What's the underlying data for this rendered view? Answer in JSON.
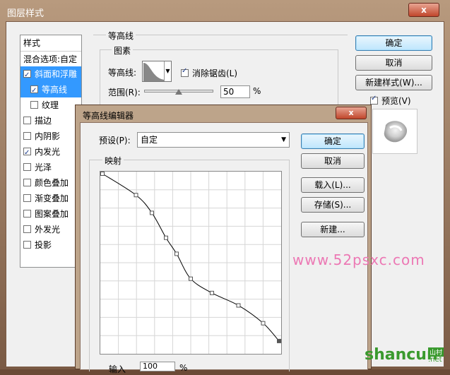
{
  "outer": {
    "title": "图层样式",
    "close_glyph": "x"
  },
  "styles_panel": {
    "header": "样式",
    "blend_label": "混合选项:自定",
    "items": [
      {
        "label": "斜面和浮雕",
        "checked": true,
        "selected": true,
        "sub": false
      },
      {
        "label": "等高线",
        "checked": true,
        "selected": true,
        "sub": true
      },
      {
        "label": "纹理",
        "checked": false,
        "selected": false,
        "sub": true
      },
      {
        "label": "描边",
        "checked": false,
        "selected": false,
        "sub": false
      },
      {
        "label": "内阴影",
        "checked": false,
        "selected": false,
        "sub": false
      },
      {
        "label": "内发光",
        "checked": true,
        "selected": false,
        "sub": false
      },
      {
        "label": "光泽",
        "checked": false,
        "selected": false,
        "sub": false
      },
      {
        "label": "颜色叠加",
        "checked": false,
        "selected": false,
        "sub": false
      },
      {
        "label": "渐变叠加",
        "checked": false,
        "selected": false,
        "sub": false
      },
      {
        "label": "图案叠加",
        "checked": false,
        "selected": false,
        "sub": false
      },
      {
        "label": "外发光",
        "checked": false,
        "selected": false,
        "sub": false
      },
      {
        "label": "投影",
        "checked": false,
        "selected": false,
        "sub": false
      }
    ]
  },
  "contour_panel": {
    "section_title": "等高线",
    "group_title": "图素",
    "contour_label": "等高线:",
    "antialias_label": "消除锯齿(L)",
    "antialias_checked": true,
    "range_label": "范围(R):",
    "range_value": "50",
    "range_unit": "%",
    "range_fraction": 0.5
  },
  "right_buttons": {
    "ok": "确定",
    "cancel": "取消",
    "new_style": "新建样式(W)...",
    "preview_label": "预览(V)",
    "preview_checked": true
  },
  "editor": {
    "title": "等高线编辑器",
    "close_glyph": "x",
    "preset_label": "预设(P):",
    "preset_value": "自定",
    "mapping_label": "映射",
    "input_label": "输入",
    "input_value": "100",
    "input_unit": "%",
    "buttons": {
      "ok": "确定",
      "cancel": "取消",
      "load": "载入(L)...",
      "save": "存储(S)...",
      "new": "新建..."
    },
    "curve_points": [
      [
        0,
        1.0
      ],
      [
        0.19,
        0.88
      ],
      [
        0.28,
        0.78
      ],
      [
        0.36,
        0.64
      ],
      [
        0.42,
        0.55
      ],
      [
        0.5,
        0.41
      ],
      [
        0.62,
        0.33
      ],
      [
        0.77,
        0.26
      ],
      [
        0.91,
        0.16
      ],
      [
        1.0,
        0.06
      ]
    ]
  },
  "watermark": "www.52psxc.com",
  "logo": {
    "text_main": "shancun",
    "text_net": ".net",
    "text_cn": "山村"
  }
}
